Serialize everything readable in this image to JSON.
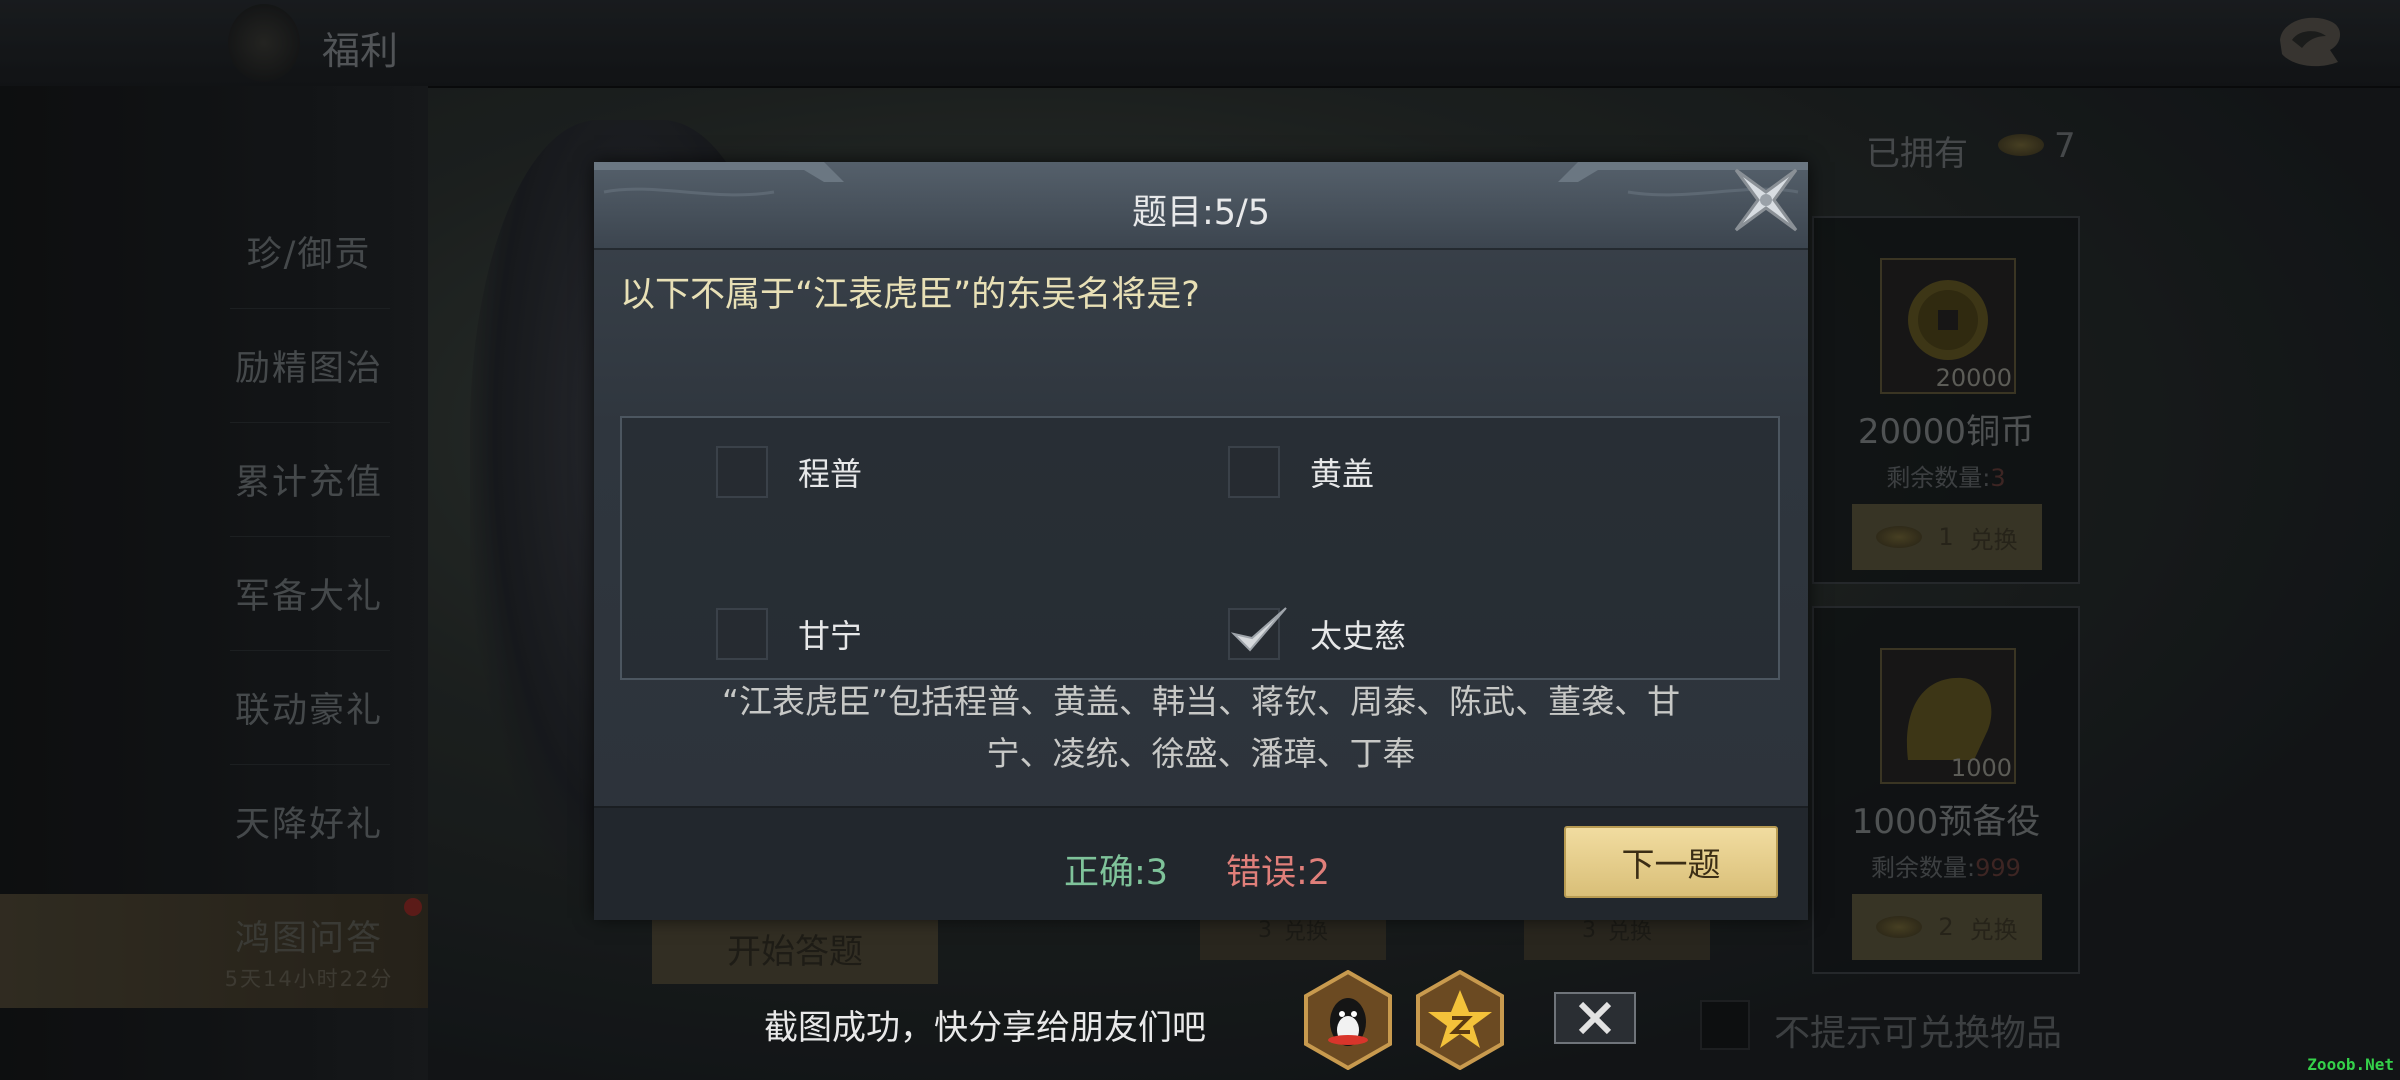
{
  "topbar": {
    "title": "福利"
  },
  "sidebar": {
    "items": [
      {
        "label": "珍/御贡"
      },
      {
        "label": "励精图治"
      },
      {
        "label": "累计充值"
      },
      {
        "label": "军备大礼"
      },
      {
        "label": "联动豪礼"
      },
      {
        "label": "天降好礼"
      },
      {
        "label": "鸿图问答",
        "sub": "5天14小时22分",
        "active": true
      }
    ]
  },
  "shop": {
    "owned_label": "已拥有",
    "owned_count": "7",
    "cards": [
      {
        "qty": "20000",
        "name": "20000铜币",
        "remain_label": "剩余数量:",
        "remain": "3",
        "cost": "1",
        "btn": "兑换"
      },
      {
        "qty": "1000",
        "name": "1000预备役",
        "remain_label": "剩余数量:",
        "remain": "999",
        "cost": "2",
        "btn": "兑换"
      }
    ],
    "under_buttons": [
      {
        "cost": "3",
        "btn": "兑换"
      },
      {
        "cost": "3",
        "btn": "兑换"
      }
    ],
    "start_button": "开始答题",
    "no_prompt": "不提示可兑换物品"
  },
  "quiz": {
    "title": "题目:5/5",
    "question": "以下不属于“江表虎臣”的东吴名将是?",
    "options": [
      {
        "label": "程普",
        "checked": false
      },
      {
        "label": "黄盖",
        "checked": false
      },
      {
        "label": "甘宁",
        "checked": false
      },
      {
        "label": "太史慈",
        "checked": true
      }
    ],
    "explanation_line1": "“江表虎臣”包括程普、黄盖、韩当、蒋钦、周泰、陈武、董袭、甘",
    "explanation_line2": "宁、凌统、徐盛、潘璋、丁奉",
    "correct": "正确:3",
    "wrong": "错误:2",
    "next_button": "下一题"
  },
  "share": {
    "text": "截图成功，快分享给朋友们吧",
    "icons": [
      "qq-icon",
      "qzone-icon"
    ]
  },
  "watermark": "Zooob.Net",
  "colors": {
    "correct": "#7fc39a",
    "wrong": "#e07f7a",
    "next_button": "#e6cc88",
    "question": "#e8e0b6"
  }
}
